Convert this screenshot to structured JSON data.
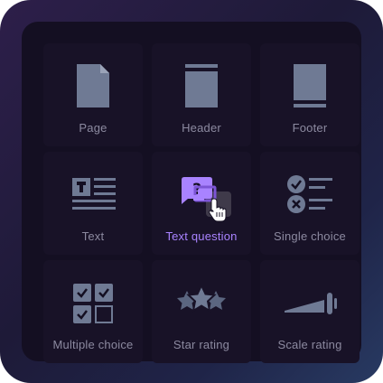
{
  "colors": {
    "icon": "#6f7a94",
    "active_accent": "#a983ff",
    "label": "#8c8aa0",
    "panel": "#140f22"
  },
  "tiles": [
    {
      "label": "Page",
      "icon": "page-icon",
      "active": false
    },
    {
      "label": "Header",
      "icon": "header-icon",
      "active": false
    },
    {
      "label": "Footer",
      "icon": "footer-icon",
      "active": false
    },
    {
      "label": "Text",
      "icon": "text-icon",
      "active": false
    },
    {
      "label": "Text question",
      "icon": "text-question-icon",
      "active": true
    },
    {
      "label": "Single choice",
      "icon": "single-choice-icon",
      "active": false
    },
    {
      "label": "Multiple choice",
      "icon": "multiple-choice-icon",
      "active": false
    },
    {
      "label": "Star rating",
      "icon": "star-rating-icon",
      "active": false
    },
    {
      "label": "Scale rating",
      "icon": "scale-rating-icon",
      "active": false
    }
  ]
}
